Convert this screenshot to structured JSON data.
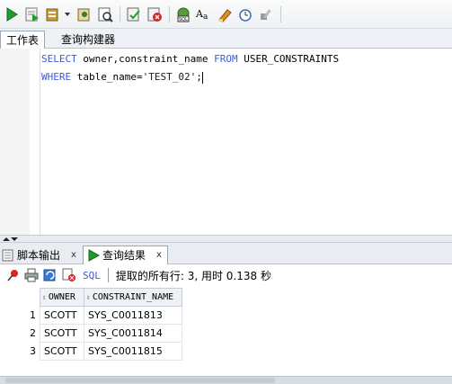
{
  "toolbar": {
    "buttons": [
      "run-statement-icon",
      "run-script-icon",
      "commit-icon",
      "explain-plan-icon",
      "autotrace-icon",
      "commit-icon-2",
      "rollback-icon",
      "sql-tuning-icon",
      "uppercase-icon",
      "clear-icon",
      "history-icon",
      "tools-icon"
    ]
  },
  "editor_tabs": {
    "worksheet": "工作表",
    "query_builder": "查询构建器"
  },
  "editor": {
    "line1": {
      "kw1": "SELECT",
      "cols": " owner,constraint_name ",
      "kw2": "FROM",
      "table": " USER_CONSTRAINTS"
    },
    "line2": {
      "kw1": "WHERE",
      "cond": " table_name=",
      "str": "'TEST_02'",
      "end": ";"
    }
  },
  "result_tabs": {
    "script_output": "脚本输出",
    "query_result": "查询结果",
    "close": "x"
  },
  "result_toolbar": {
    "sql_label": "SQL",
    "status": "提取的所有行: 3, 用时 0.138 秒"
  },
  "grid": {
    "columns": [
      "OWNER",
      "CONSTRAINT_NAME"
    ],
    "rows": [
      {
        "n": "1",
        "owner": "SCOTT",
        "name": "SYS_C0011813"
      },
      {
        "n": "2",
        "owner": "SCOTT",
        "name": "SYS_C0011814"
      },
      {
        "n": "3",
        "owner": "SCOTT",
        "name": "SYS_C0011815"
      }
    ]
  },
  "colors": {
    "keyword": "#3b5bd6",
    "run_green": "#1f9d2a"
  }
}
